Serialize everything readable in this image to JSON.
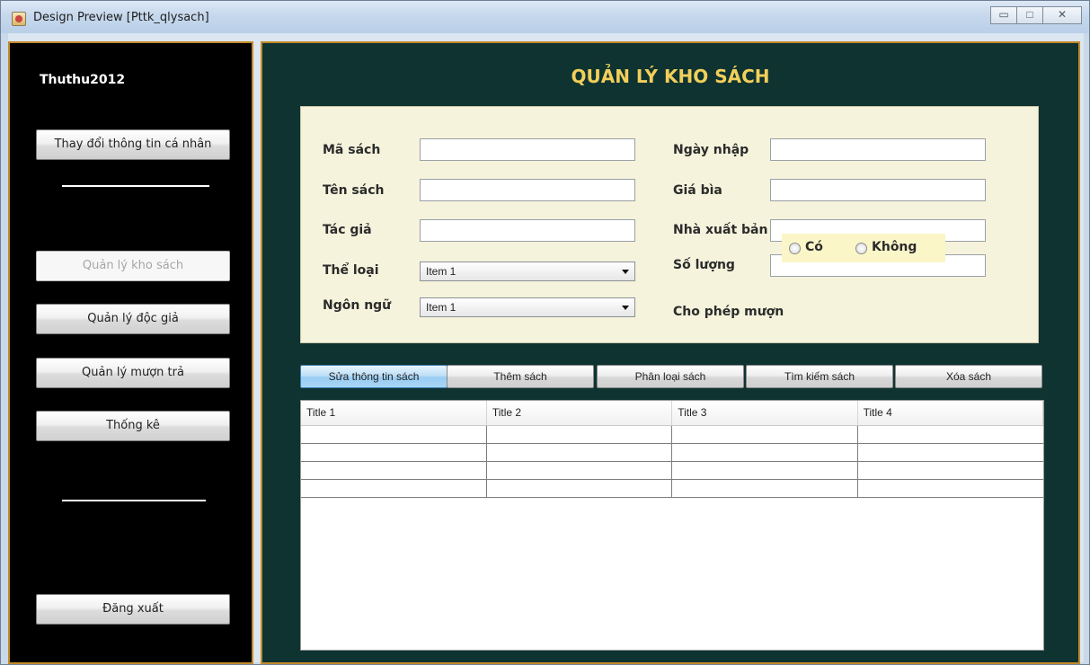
{
  "window": {
    "title": "Design Preview [Pttk_qlysach]"
  },
  "sidebar": {
    "user": "Thuthu2012",
    "buttons": {
      "profile": "Thay đổi thông tin cá nhân",
      "books": "Quản lý kho sách",
      "readers": "Quản lý độc giả",
      "loans": "Quản lý mượn trả",
      "stats": "Thống kê",
      "logout": "Đăng xuất"
    }
  },
  "main": {
    "title": "QUẢN LÝ KHO SÁCH",
    "form": {
      "ma_sach": {
        "label": "Mã sách",
        "value": ""
      },
      "ten_sach": {
        "label": "Tên sách",
        "value": ""
      },
      "tac_gia": {
        "label": "Tác giả",
        "value": ""
      },
      "the_loai": {
        "label": "Thể loại",
        "selected": "Item 1"
      },
      "ngon_ngu": {
        "label": "Ngôn ngữ",
        "selected": "Item 1"
      },
      "ngay_nhap": {
        "label": "Ngày nhập",
        "value": ""
      },
      "gia_bia": {
        "label": "Giá bìa",
        "value": ""
      },
      "nha_xuat_ban": {
        "label": "Nhà xuất bản",
        "value": ""
      },
      "so_luong": {
        "label": "Số lượng",
        "value": ""
      },
      "cho_phep_muon": {
        "label": "Cho phép mượn",
        "option_yes": "Có",
        "option_no": "Không"
      }
    },
    "actions": {
      "edit": "Sửa thông tin sách",
      "add": "Thêm sách",
      "classify": "Phân loại sách",
      "search": "Tìm kiếm sách",
      "delete": "Xóa sách"
    },
    "table": {
      "columns": [
        "Title 1",
        "Title 2",
        "Title 3",
        "Title 4"
      ]
    }
  }
}
